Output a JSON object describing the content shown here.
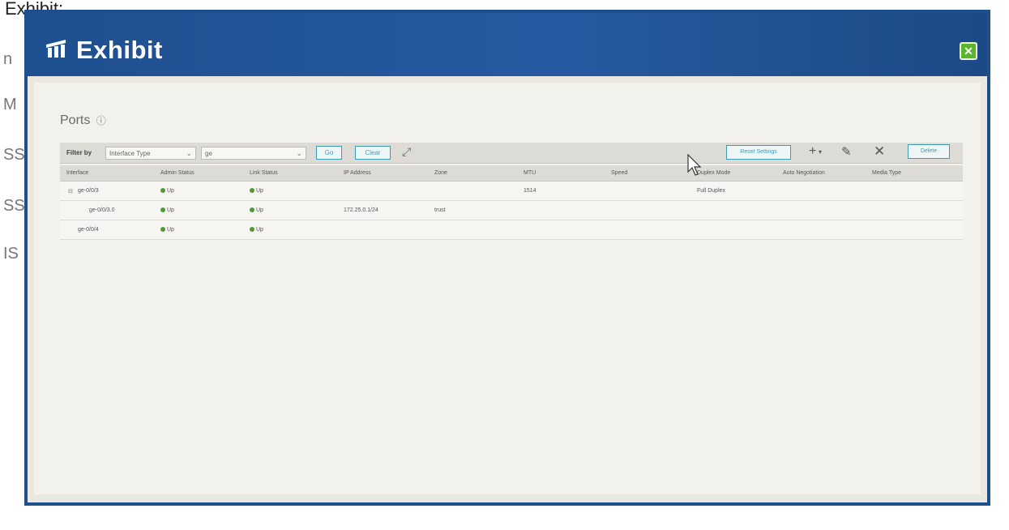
{
  "background": {
    "label": "Exhibit:",
    "strip_letters": [
      "n",
      "M",
      "SS",
      "SS",
      "IS"
    ]
  },
  "window": {
    "title": "Exhibit",
    "close_label": "✕",
    "colors": {
      "titlebar": "#1e4f90",
      "close": "#5ab52c",
      "accent": "#3f9ab4",
      "status_up": "#4b9a37"
    }
  },
  "ports": {
    "title": "Ports",
    "help_glyph": "ⓘ",
    "toolbar": {
      "filter_label": "Filter by",
      "filter_type": "Interface Type",
      "filter_value": "ge",
      "go_label": "Go",
      "clear_label": "Clear",
      "reset_label": "Reset Settings",
      "delete_label": "Delete"
    },
    "columns": [
      "Interface",
      "Admin Status",
      "Link Status",
      "IP Address",
      "Zone",
      "MTU",
      "Speed",
      "Duplex Mode",
      "Auto Negotiation",
      "Media Type"
    ],
    "rows": [
      {
        "interface": "ge-0/0/3",
        "admin_status": "Up",
        "link_status": "Up",
        "ip": "",
        "zone": "",
        "mtu": "1514",
        "speed": "",
        "duplex": "Full Duplex",
        "tree": "⊟"
      },
      {
        "interface": "ge-0/0/3.0",
        "admin_status": "Up",
        "link_status": "Up",
        "ip": "172.25.0.1/24",
        "zone": "trust",
        "mtu": "",
        "speed": "",
        "duplex": "",
        "tree": ""
      },
      {
        "interface": "ge-0/0/4",
        "admin_status": "Up",
        "link_status": "Up",
        "ip": "",
        "zone": "",
        "mtu": "",
        "speed": "",
        "duplex": "",
        "tree": ""
      }
    ]
  }
}
